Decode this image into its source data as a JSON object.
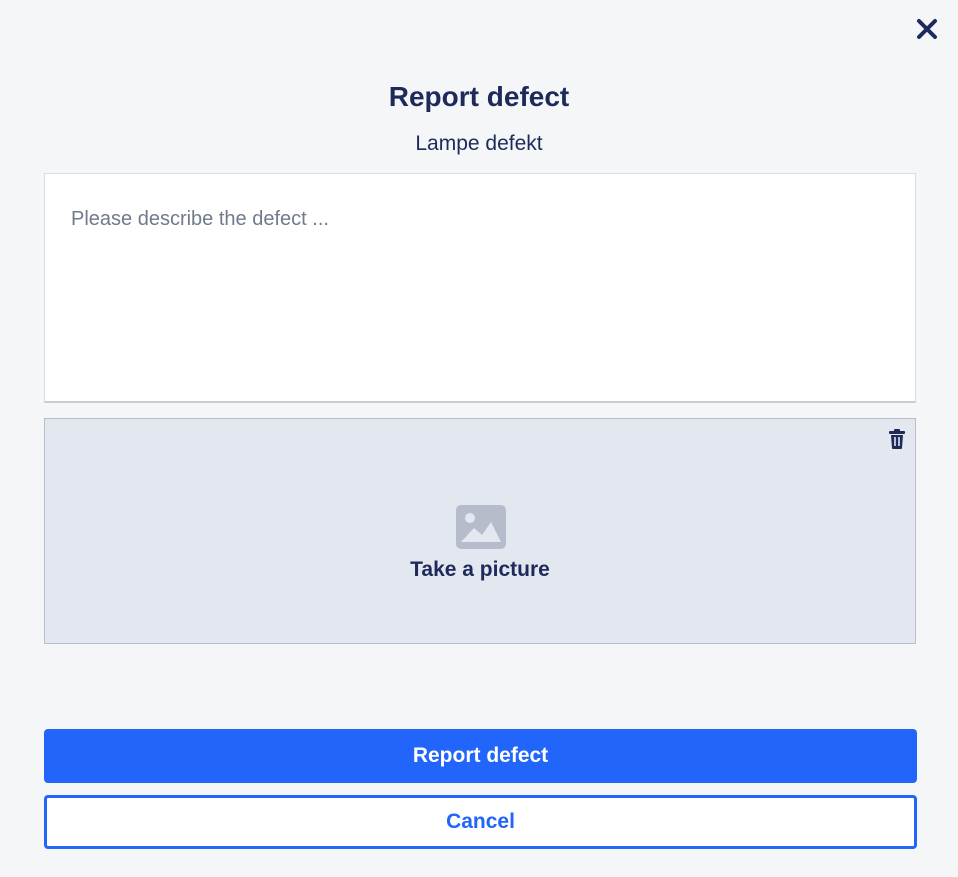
{
  "dialog": {
    "title": "Report defect",
    "subtitle": "Lampe defekt",
    "close_icon": "close-icon"
  },
  "description": {
    "value": "",
    "placeholder": "Please describe the defect ..."
  },
  "picture": {
    "label": "Take a picture",
    "icon": "image-placeholder-icon",
    "delete_icon": "trash-icon"
  },
  "actions": {
    "submit_label": "Report defect",
    "cancel_label": "Cancel"
  },
  "colors": {
    "primary": "#2165fa",
    "text": "#1e2a5a",
    "background": "#f4f6f8",
    "picture_area": "#e3e7ef",
    "placeholder": "#6f7a8c"
  }
}
